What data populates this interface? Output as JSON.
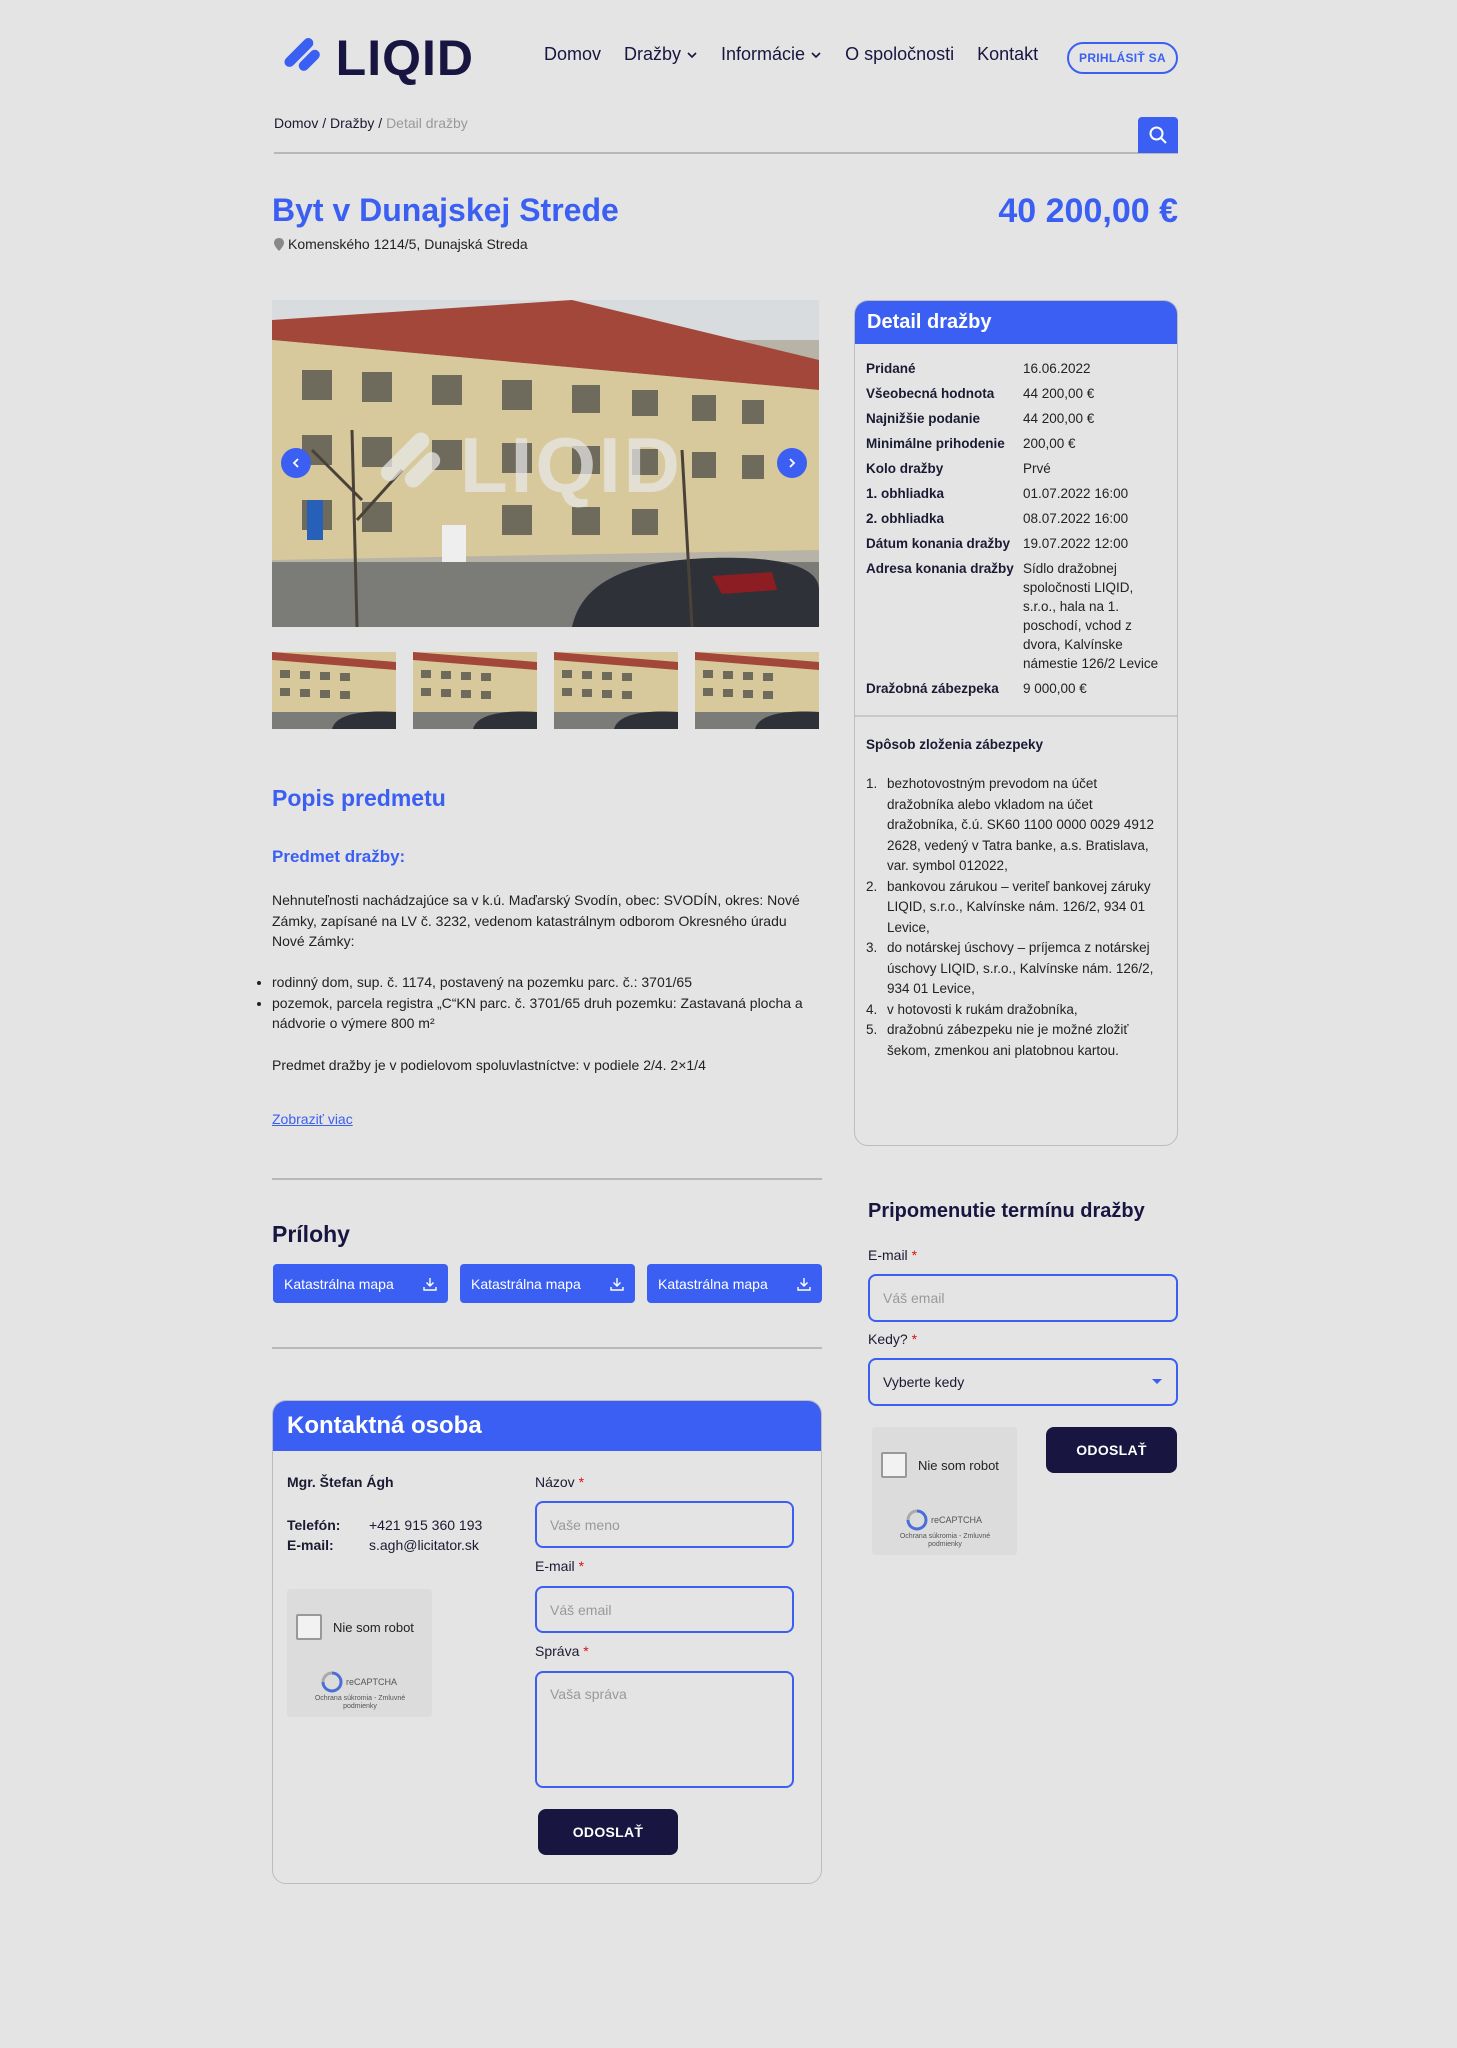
{
  "brand": {
    "logo_text": "LIQID",
    "accent": "#3a5ff2",
    "dark": "#181640"
  },
  "nav": {
    "items": [
      {
        "label": "Domov",
        "dropdown": false
      },
      {
        "label": "Dražby",
        "dropdown": true
      },
      {
        "label": "Informácie",
        "dropdown": true
      },
      {
        "label": "O spoločnosti",
        "dropdown": false
      },
      {
        "label": "Kontakt",
        "dropdown": false
      }
    ],
    "login_label": "PRIHLÁSIŤ SA"
  },
  "breadcrumb": {
    "home": "Domov",
    "sep1": " / ",
    "auctions": "Dražby",
    "sep2": " / ",
    "current": "Detail dražby"
  },
  "listing": {
    "title": "Byt v Dunajskej Strede",
    "price": "40 200,00 €",
    "address": "Komenského 1214/5, Dunajská Streda",
    "watermark": "LIQID"
  },
  "description": {
    "section_title": "Popis predmetu",
    "subtitle": "Predmet dražby:",
    "intro": "Nehnuteľnosti nachádzajúce sa v k.ú.  Maďarský Svodín, obec: SVODÍN, okres: Nové Zámky, zapísané na LV č. 3232, vedenom katastrálnym odborom Okresného úradu Nové Zámky:",
    "bullets": [
      "rodinný dom, sup. č. 1174, postavený na pozemku parc. č.: 3701/65",
      "pozemok, parcela registra „C“KN  parc. č. 3701/65   druh pozemku: Zastavaná plocha a nádvorie o výmere 800 m²"
    ],
    "share": "Predmet dražby je v podielovom spoluvlastníctve: v podiele 2/4. 2×1/4",
    "more_link": "Zobraziť viac"
  },
  "attachments": {
    "title": "Prílohy",
    "items": [
      "Katastrálna mapa",
      "Katastrálna mapa",
      "Katastrálna mapa"
    ]
  },
  "contact": {
    "title": "Kontaktná osoba",
    "name": "Mgr. Štefan Ágh",
    "phone_label": "Telefón:",
    "phone": "+421 915 360 193",
    "email_label": "E-mail:",
    "email": "s.agh@licitator.sk",
    "form": {
      "name_label": "Názov",
      "name_placeholder": "Vaše meno",
      "email_label": "E-mail",
      "email_placeholder": "Váš email",
      "message_label": "Správa",
      "message_placeholder": "Vaša správa",
      "submit": "ODOSLAŤ"
    }
  },
  "captcha": {
    "label": "Nie som robot",
    "brand": "reCAPTCHA",
    "footer": "Ochrana súkromia - Zmluvné podmienky"
  },
  "detail": {
    "title": "Detail dražby",
    "rows": [
      {
        "k": "Pridané",
        "v": "16.06.2022"
      },
      {
        "k": "Všeobecná hodnota",
        "v": "44 200,00 €"
      },
      {
        "k": "Najnižšie podanie",
        "v": "44 200,00 €"
      },
      {
        "k": "Minimálne prihodenie",
        "v": "200,00 €"
      },
      {
        "k": "Kolo dražby",
        "v": "Prvé"
      },
      {
        "k": "1. obhliadka",
        "v": "01.07.2022 16:00"
      },
      {
        "k": "2. obhliadka",
        "v": "08.07.2022 16:00"
      },
      {
        "k": "Dátum konania dražby",
        "v": "19.07.2022 12:00"
      },
      {
        "k": "Adresa konania dražby",
        "v": "Sídlo dražobnej spoločnosti LIQID, s.r.o., hala na 1. poschodí, vchod z dvora, Kalvínske námestie 126/2 Levice"
      },
      {
        "k": "Dražobná zábezpeka",
        "v": "9 000,00 €"
      }
    ],
    "deposit_title": "Spôsob zloženia zábezpeky",
    "deposit_methods": [
      "bezhotovostným prevodom na účet dražobníka alebo vkladom na účet dražobníka, č.ú.  SK60 1100 0000 0029 4912 2628, vedený v Tatra banke, a.s. Bratislava, var. symbol  012022,",
      "bankovou zárukou – veriteľ bankovej záruky  LIQID, s.r.o., Kalvínske nám. 126/2, 934 01 Levice,",
      "do notárskej úschovy – príjemca z notárskej úschovy LIQID, s.r.o., Kalvínske nám. 126/2, 934 01 Levice,",
      "v hotovosti k rukám dražobníka,",
      "dražobnú zábezpeku nie je možné  zložiť šekom, zmenkou ani platobnou kartou."
    ]
  },
  "reminder": {
    "title": "Pripomenutie termínu dražby",
    "email_label": "E-mail",
    "email_placeholder": "Váš email",
    "when_label": "Kedy?",
    "when_value": "Vyberte kedy",
    "submit": "ODOSLAŤ"
  }
}
